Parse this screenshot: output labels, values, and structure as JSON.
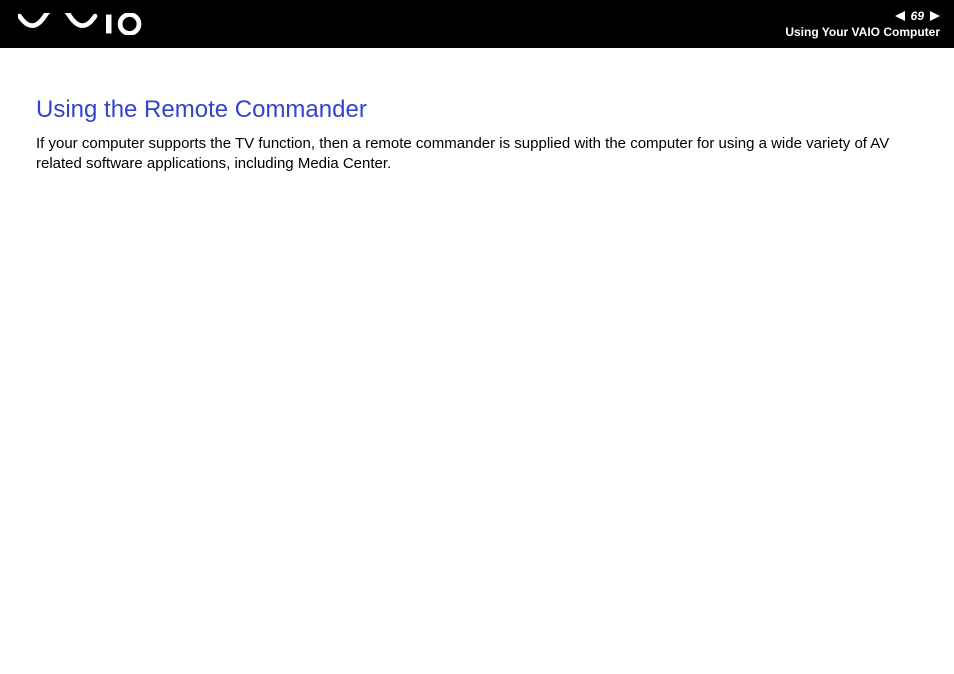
{
  "header": {
    "page_number": "69",
    "section_label": "Using Your VAIO Computer"
  },
  "content": {
    "heading": "Using the Remote Commander",
    "body": "If your computer supports the TV function, then a remote commander is supplied with the computer for using a wide variety of AV related software applications, including Media Center."
  }
}
